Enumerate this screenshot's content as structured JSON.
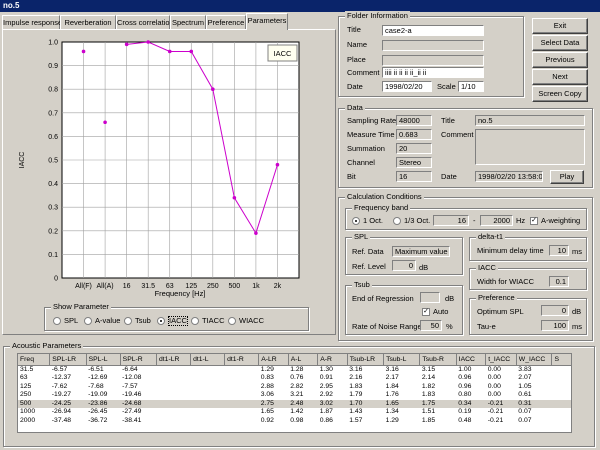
{
  "window": {
    "title": "no.5"
  },
  "tabs": [
    {
      "label": "Impulse response"
    },
    {
      "label": "Reverberation"
    },
    {
      "label": "Cross correlation"
    },
    {
      "label": "Spectrum"
    },
    {
      "label": "Preference"
    },
    {
      "label": "Parameters"
    }
  ],
  "chart_data": {
    "type": "line",
    "legend": "IACC",
    "xlabel": "Frequency [Hz]",
    "ylabel": "IACC",
    "categories": [
      "All(F)",
      "All(A)",
      "16",
      "31.5",
      "63",
      "125",
      "250",
      "500",
      "1k",
      "2k"
    ],
    "ylim": [
      0,
      1
    ],
    "yticks": [
      "0",
      "0.1",
      "0.2",
      "0.3",
      "0.4",
      "0.5",
      "0.6",
      "0.7",
      "0.8",
      "0.9",
      "1.0"
    ],
    "points": [
      {
        "x": "All(F)",
        "y": 0.96
      },
      {
        "x": "All(A)",
        "y": 0.66
      },
      {
        "x": "16",
        "y": 0.99
      },
      {
        "x": "31.5",
        "y": 1.0
      },
      {
        "x": "63",
        "y": 0.96
      },
      {
        "x": "125",
        "y": 0.96
      },
      {
        "x": "250",
        "y": 0.8
      },
      {
        "x": "500",
        "y": 0.34
      },
      {
        "x": "1k",
        "y": 0.19
      },
      {
        "x": "2k",
        "y": 0.48
      }
    ],
    "connected_from": 2,
    "color": "#cc00cc"
  },
  "show_parameter": {
    "title": "Show Parameter",
    "options": [
      {
        "label": "SPL",
        "selected": false
      },
      {
        "label": "A-value",
        "selected": false
      },
      {
        "label": "Tsub",
        "selected": false
      },
      {
        "label": "IACC",
        "selected": true
      },
      {
        "label": "TIACC",
        "selected": false
      },
      {
        "label": "WIACC",
        "selected": false
      }
    ]
  },
  "folder": {
    "title": "Folder Information",
    "title_label": "Title",
    "title_value": "case2-a",
    "name_label": "Name",
    "name_value": "",
    "place_label": "Place",
    "place_value": "",
    "comment_label": "Comment",
    "comment_value": "iiii ii ii ii ii_ii ii",
    "date_label": "Date",
    "date_value": "1998/02/20",
    "scale_label": "Scale",
    "scale_value": "1/10"
  },
  "buttons": {
    "exit": "Exit",
    "select_data": "Select Data",
    "previous": "Previous",
    "next": "Next",
    "screen_copy": "Screen Copy"
  },
  "data_info": {
    "title": "Data",
    "sampling_rate_label": "Sampling Rate",
    "sampling_rate": "48000",
    "measure_time_label": "Measure Time",
    "measure_time": "0.683",
    "summation_label": "Summation",
    "summation": "20",
    "channel_label": "Channel",
    "channel": "Stereo",
    "bit_label": "Bit",
    "bit": "16",
    "title_label": "Title",
    "title_value": "no.5",
    "comment_label": "Comment",
    "date_label": "Date",
    "date_value": "1998/02/20 13:58:08",
    "play": "Play"
  },
  "calc": {
    "title": "Calculation Conditions",
    "freq_band_title": "Frequency band",
    "oct1": "1 Oct.",
    "oct3": "1/3 Oct.",
    "freq_from": "16",
    "freq_to": "2000",
    "hz": "Hz",
    "a_weighting": "A-weighting",
    "spl_title": "SPL",
    "ref_data_label": "Ref. Data",
    "ref_data_value": "Maximum value",
    "ref_level_label": "Ref. Level",
    "ref_level_value": "0",
    "db": "dB",
    "delta_title": "delta-t1",
    "min_delay_label": "Minimum delay time",
    "min_delay_value": "10",
    "ms": "ms",
    "iacc_title": "IACC",
    "wiacc_label": "Width for WIACC",
    "wiacc_value": "0.1",
    "tsub_title": "Tsub",
    "end_reg_label": "End of Regression",
    "end_reg_value": "",
    "auto_label": "Auto",
    "noise_label": "Rate of Noise Range",
    "noise_value": "50",
    "pct": "%",
    "pref_title": "Preference",
    "opt_spl_label": "Optimum SPL",
    "opt_spl_value": "0",
    "taue_label": "Tau-e",
    "taue_value": "100"
  },
  "acoustic": {
    "title": "Acoustic Parameters",
    "columns": [
      "Freq",
      "SPL-LR",
      "SPL-L",
      "SPL-R",
      "dt1-LR",
      "dt1-L",
      "dt1-R",
      "A-LR",
      "A-L",
      "A-R",
      "Tsub-LR",
      "Tsub-L",
      "Tsub-R",
      "IACC",
      "t_IACC",
      "W_IACC",
      "S"
    ],
    "rows": [
      [
        "31.5",
        "-6.57",
        "-6.51",
        "-6.64",
        "",
        "",
        "",
        "1.29",
        "1.28",
        "1.30",
        "3.16",
        "3.16",
        "3.15",
        "1.00",
        "0.00",
        "3.83",
        ""
      ],
      [
        "63",
        "-12.37",
        "-12.69",
        "-12.08",
        "",
        "",
        "",
        "0.83",
        "0.76",
        "0.91",
        "2.16",
        "2.17",
        "2.14",
        "0.96",
        "0.00",
        "2.07",
        ""
      ],
      [
        "125",
        "-7.62",
        "-7.68",
        "-7.57",
        "",
        "",
        "",
        "2.88",
        "2.82",
        "2.95",
        "1.83",
        "1.84",
        "1.82",
        "0.96",
        "0.00",
        "1.05",
        ""
      ],
      [
        "250",
        "-19.27",
        "-19.09",
        "-19.46",
        "",
        "",
        "",
        "3.06",
        "3.21",
        "2.92",
        "1.79",
        "1.76",
        "1.83",
        "0.80",
        "0.00",
        "0.61",
        ""
      ],
      [
        "500",
        "-24.25",
        "-23.86",
        "-24.68",
        "",
        "",
        "",
        "2.75",
        "2.48",
        "3.02",
        "1.70",
        "1.65",
        "1.75",
        "0.34",
        "-0.21",
        "0.31",
        ""
      ],
      [
        "1000",
        "-26.94",
        "-26.45",
        "-27.49",
        "",
        "",
        "",
        "1.65",
        "1.42",
        "1.87",
        "1.43",
        "1.34",
        "1.51",
        "0.19",
        "-0.21",
        "0.07",
        ""
      ],
      [
        "2000",
        "-37.48",
        "-36.72",
        "-38.41",
        "",
        "",
        "",
        "0.92",
        "0.98",
        "0.86",
        "1.57",
        "1.29",
        "1.85",
        "0.48",
        "-0.21",
        "0.07",
        ""
      ]
    ],
    "selected_row": 4
  }
}
